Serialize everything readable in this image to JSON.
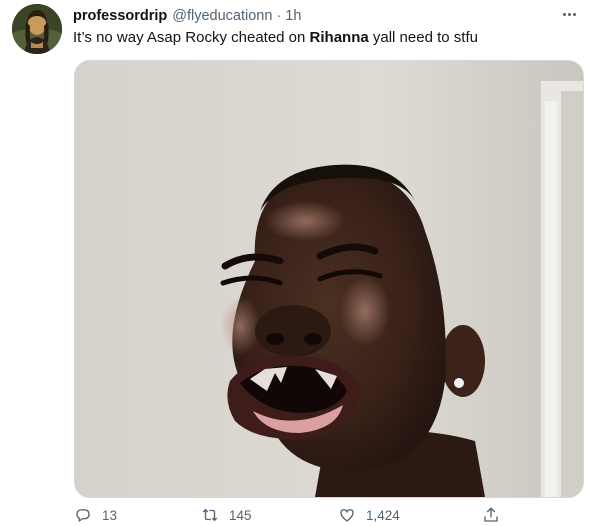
{
  "author": {
    "display_name": "professordrip",
    "handle": "@flyeducationn",
    "separator": "·",
    "time": "1h",
    "avatar_icon": "mona-lisa-avatar"
  },
  "tweet": {
    "text_before": "It’s no way Asap Rocky cheated on ",
    "text_bold": "Rihanna",
    "text_after": " yall need to stfu"
  },
  "media": {
    "description_icon": "crying-man-photo"
  },
  "actions": {
    "reply_count": "13",
    "retweet_count": "145",
    "like_count": "1,424"
  },
  "colors": {
    "text": "#0f1419",
    "secondary": "#536471",
    "border": "#cfd9de"
  }
}
